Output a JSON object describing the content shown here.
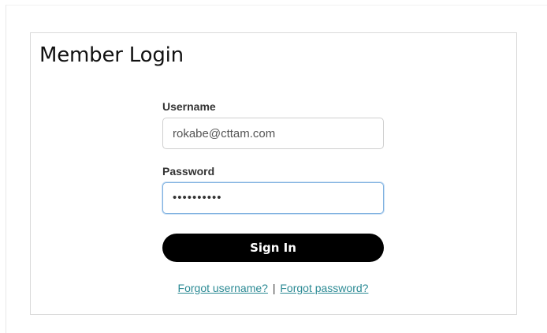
{
  "login": {
    "title": "Member Login",
    "username_label": "Username",
    "username_value": "rokabe@cttam.com",
    "password_label": "Password",
    "password_masked": "••••••••••",
    "signin_label": "Sign In",
    "forgot_username": "Forgot username?",
    "separator": "|",
    "forgot_password": "Forgot password?"
  },
  "colors": {
    "button_bg": "#000000",
    "link": "#2b8a94",
    "focus_border": "#7fb1e0"
  }
}
